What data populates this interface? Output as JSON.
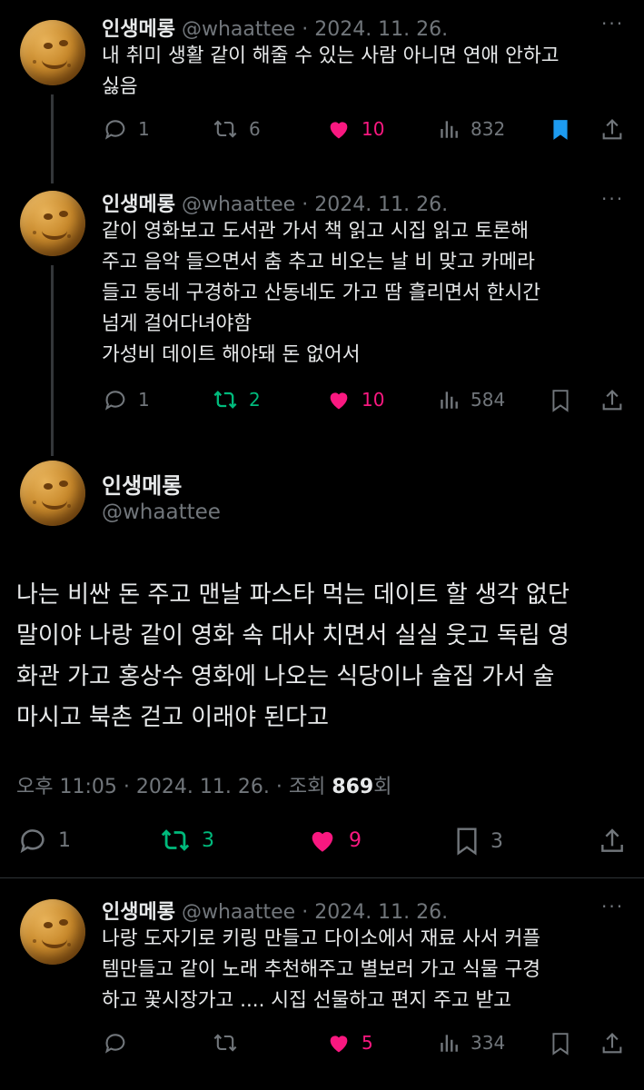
{
  "colors": {
    "background": "#000000",
    "text": "#e7e9ea",
    "muted": "#71767b",
    "like": "#f91880",
    "retweet": "#00ba7c",
    "bookmark": "#1d9bf0"
  },
  "tweets": [
    {
      "name": "인생메롱",
      "handle": "@whaattee",
      "date": "2024. 11. 26.",
      "lines": [
        "내 취미 생활 같이 해줄 수 있는 사람 아니면 연애 안하고",
        "싫음"
      ],
      "replies": "1",
      "retweets": "6",
      "likes": "10",
      "views": "832",
      "bookmarked": true
    },
    {
      "name": "인생메롱",
      "handle": "@whaattee",
      "date": "2024. 11. 26.",
      "lines": [
        "같이 영화보고 도서관 가서 책 읽고 시집 읽고 토론해",
        "주고 음악 들으면서 춤 추고 비오는 날 비 맞고 카메라",
        "들고 동네 구경하고 산동네도 가고 땀 흘리면서 한시간",
        "넘게 걸어다녀야함",
        "가성비 데이트 해야돼 돈 없어서"
      ],
      "replies": "1",
      "retweets": "2",
      "likes": "10",
      "views": "584",
      "retweeted": true
    }
  ],
  "main": {
    "name": "인생메롱",
    "handle": "@whaattee",
    "lines": [
      "나는 비싼 돈 주고 맨날 파스타 먹는 데이트 할 생각 없단",
      "말이야 나랑 같이  영화 속 대사 치면서 실실 웃고 독립 영",
      "화관 가고 홍상수 영화에 나오는 식당이나 술집 가서 술",
      "마시고 북촌 걷고 이래야 된다고"
    ],
    "time": "오후 11:05",
    "date": "2024. 11. 26.",
    "views_label": "조회",
    "views": "869",
    "views_suffix": "회",
    "replies": "1",
    "retweets": "3",
    "likes": "9",
    "bookmarks": "3"
  },
  "reply": {
    "name": "인생메롱",
    "handle": "@whaattee",
    "date": "2024. 11. 26.",
    "lines": [
      "나랑 도자기로 키링 만들고 다이소에서 재료 사서 커플",
      "템만들고 같이 노래 추천해주고 별보러 가고 식물 구경",
      "하고 꽃시장가고 .... 시집 선물하고 편지 주고 받고"
    ],
    "likes": "5",
    "views": "334"
  },
  "labels": {
    "dot": "·",
    "more": "···"
  }
}
